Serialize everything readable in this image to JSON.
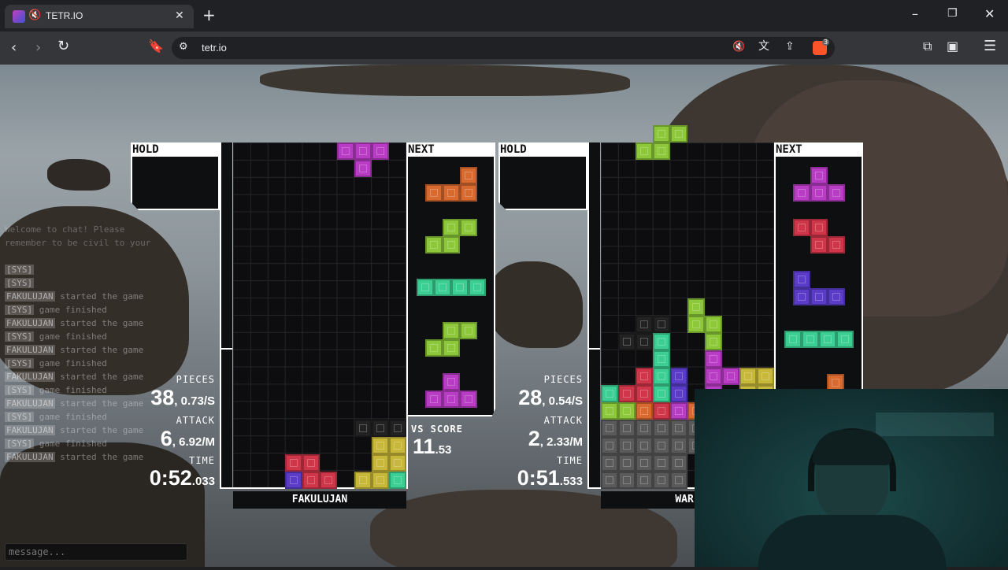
{
  "browser": {
    "tab_title": "TETR.IO",
    "url": "tetr.io",
    "new_tab_label": "+",
    "extension_badge": "3"
  },
  "player1": {
    "name": "FAKULUJAN",
    "hold_label": "HOLD",
    "next_label": "NEXT",
    "pieces_label": "PIECES",
    "pieces_value": "38",
    "pieces_rate": "0.73/S",
    "attack_label": "ATTACK",
    "attack_value": "6",
    "attack_rate": "6.92/M",
    "time_label": "TIME",
    "time_main": "0:52",
    "time_ms": ".033",
    "vs_score_label": "VS SCORE",
    "vs_score_main": "11",
    "vs_score_frac": ".53"
  },
  "player2": {
    "name": "WARL",
    "hold_label": "HOLD",
    "next_label": "NEXT",
    "pieces_label": "PIECES",
    "pieces_value": "28",
    "pieces_rate": "0.54/S",
    "attack_label": "ATTACK",
    "attack_value": "2",
    "attack_rate": "2.33/M",
    "time_label": "TIME",
    "time_main": "0:51",
    "time_ms": ".533"
  },
  "chat": {
    "welcome_line1": "Welcome to chat! Please",
    "welcome_line2": "remember to be civil to your",
    "lines": [
      {
        "name": "[SYS]",
        "text": ""
      },
      {
        "name": "[SYS]",
        "text": ""
      },
      {
        "name": "FAKULUJAN",
        "text": "started the game"
      },
      {
        "name": "[SYS]",
        "text": "game finished"
      },
      {
        "name": "FAKULUJAN",
        "text": "started the game"
      },
      {
        "name": "[SYS]",
        "text": "game finished"
      },
      {
        "name": "FAKULUJAN",
        "text": "started the game"
      },
      {
        "name": "[SYS]",
        "text": "game finished"
      },
      {
        "name": "FAKULUJAN",
        "text": "started the game"
      },
      {
        "name": "[SYS]",
        "text": "game finished"
      },
      {
        "name": "FAKULUJAN",
        "text": "started the game"
      },
      {
        "name": "[SYS]",
        "text": "game finished"
      },
      {
        "name": "FAKULUJAN",
        "text": "started the game"
      },
      {
        "name": "[SYS]",
        "text": "game finished"
      },
      {
        "name": "FAKULUJAN",
        "text": "started the game"
      }
    ],
    "input_placeholder": "message..."
  },
  "colors": {
    "T": "#b83cc4",
    "L": "#d86a30",
    "S": "#8cc83a",
    "Z": "#d0364a",
    "I": "#3ccf93",
    "J": "#5a3cc8",
    "O": "#c8b83a",
    "garbage": "#5a5a5a",
    "ghost": "#222"
  }
}
